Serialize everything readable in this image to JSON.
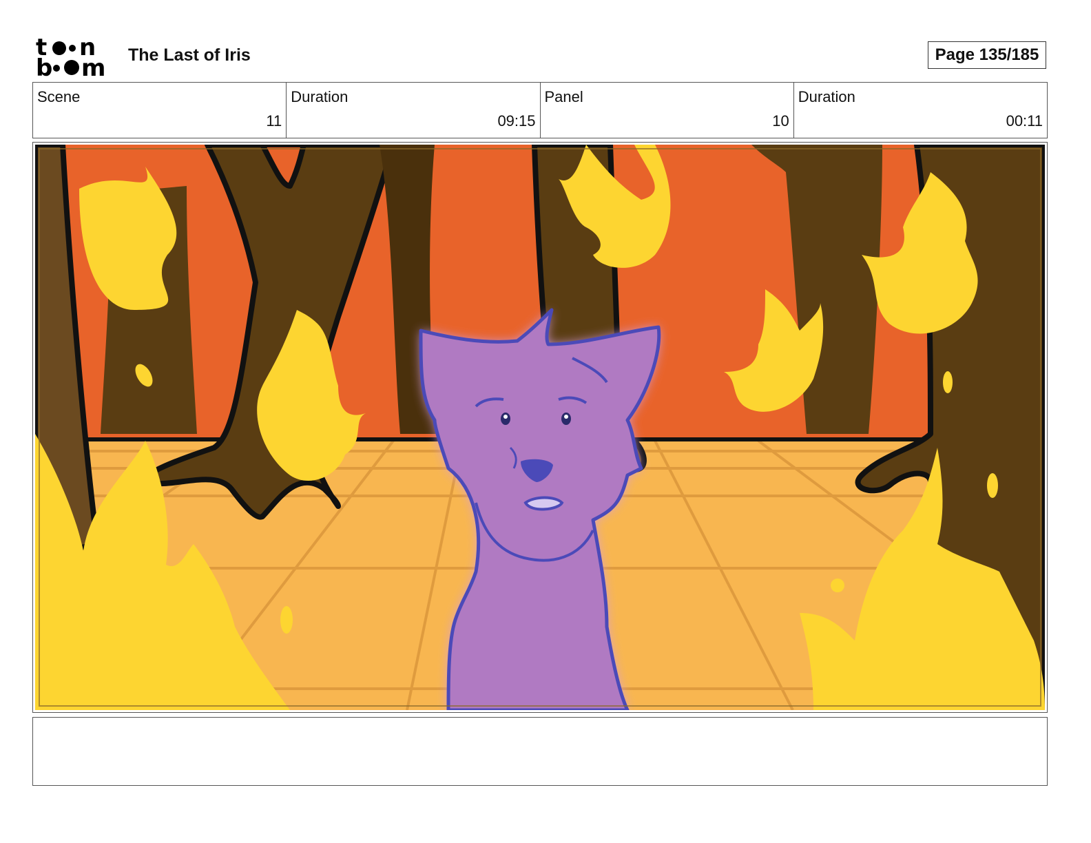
{
  "header": {
    "logo_alt": "toon boom",
    "project_title": "The Last of Iris",
    "page_label": "Page 135/185"
  },
  "info": {
    "scene_label": "Scene",
    "scene_value": "11",
    "scene_duration_label": "Duration",
    "scene_duration_value": "09:15",
    "panel_label": "Panel",
    "panel_value": "10",
    "panel_duration_label": "Duration",
    "panel_duration_value": "00:11"
  },
  "notes": {
    "text": ""
  },
  "colors": {
    "sky": "#e8632a",
    "floor": "#f8b650",
    "trunk": "#5a3d12",
    "flame": "#fdd531",
    "wolf": "#b07ac2",
    "wolf_outline": "#4b4ab8"
  }
}
